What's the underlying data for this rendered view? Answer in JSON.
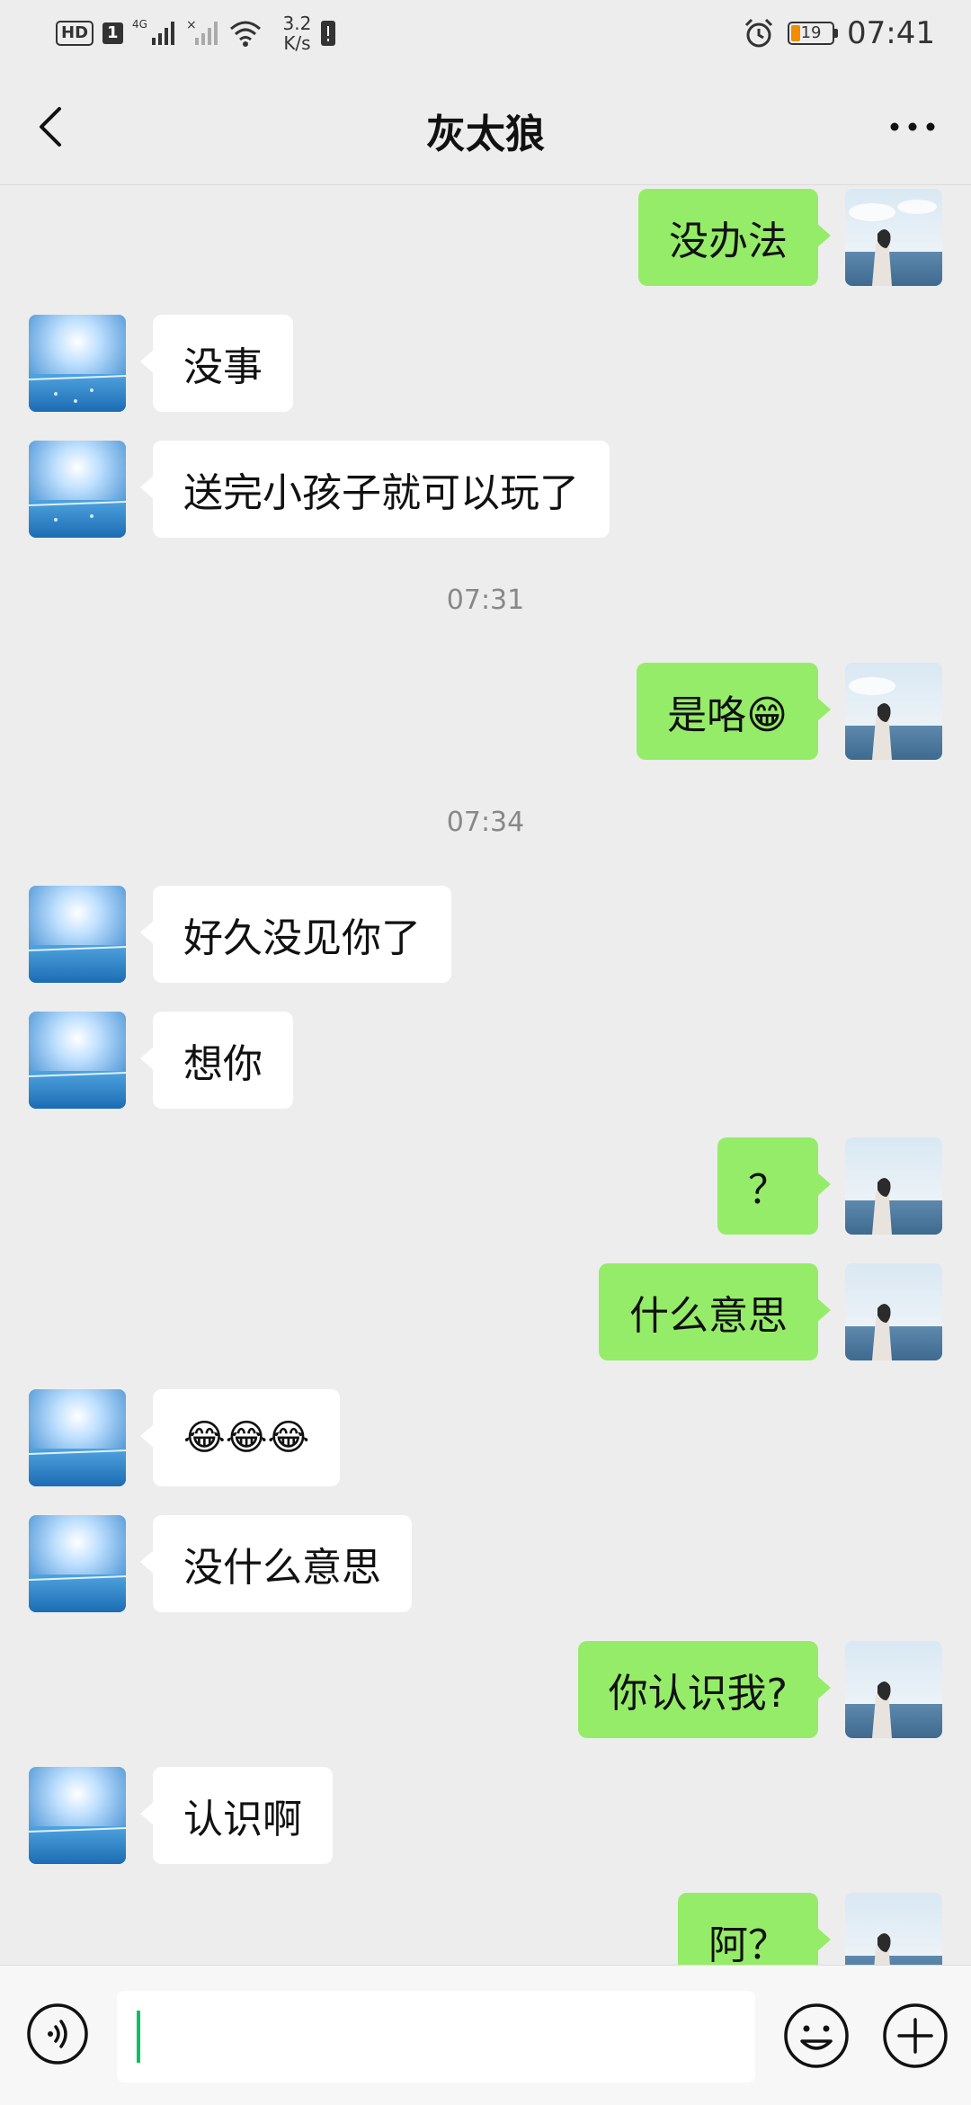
{
  "status_bar": {
    "hd": "HD",
    "sim": "1",
    "network": "4G",
    "speed_value": "3.2",
    "speed_unit": "K/s",
    "battery_level": "19",
    "time": "07:41"
  },
  "header": {
    "title": "灰太狼"
  },
  "messages": [
    {
      "side": "out",
      "text": "没办法"
    },
    {
      "side": "in",
      "text": "没事"
    },
    {
      "side": "in",
      "text": "送完小孩子就可以玩了"
    },
    {
      "type": "time",
      "text": "07:31"
    },
    {
      "side": "out",
      "text": "是咯😁"
    },
    {
      "type": "time",
      "text": "07:34"
    },
    {
      "side": "in",
      "text": "好久没见你了"
    },
    {
      "side": "in",
      "text": "想你"
    },
    {
      "side": "out",
      "text": "？"
    },
    {
      "side": "out",
      "text": "什么意思"
    },
    {
      "side": "in",
      "text": "😂😂😂"
    },
    {
      "side": "in",
      "text": "没什么意思"
    },
    {
      "side": "out",
      "text": "你认识我?"
    },
    {
      "side": "in",
      "text": "认识啊"
    },
    {
      "side": "out",
      "text": "阿？"
    }
  ],
  "input": {
    "value": ""
  },
  "colors": {
    "outgoing_bubble": "#95ec69",
    "incoming_bubble": "#ffffff",
    "background": "#ededed",
    "caret": "#07c160"
  }
}
